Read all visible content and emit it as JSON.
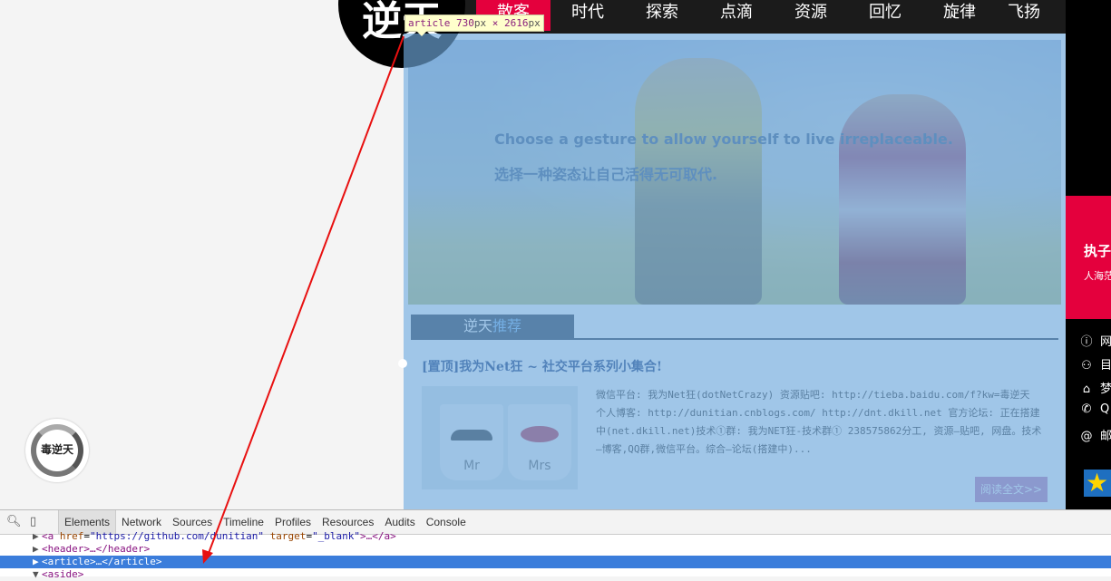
{
  "left": {
    "widget_text": "毒逆天"
  },
  "logo": {
    "text": "逆天"
  },
  "nav": {
    "items": [
      {
        "label": "散客",
        "active": true
      },
      {
        "label": "时代"
      },
      {
        "label": "探索"
      },
      {
        "label": "点滴"
      },
      {
        "label": "资源"
      },
      {
        "label": "回忆"
      },
      {
        "label": "旋律"
      },
      {
        "label": "飞扬"
      }
    ]
  },
  "inspect_tooltip": {
    "tag": "article",
    "width": "730",
    "unit": "px",
    "times": "×",
    "height": "2616"
  },
  "hero": {
    "line1": "Choose a gesture to allow yourself to live irreplaceable.",
    "line2": "选择一种姿态让自己活得无可取代."
  },
  "section": {
    "tab_prefix": "逆天",
    "tab_highlight": "推荐"
  },
  "post": {
    "title": "[置顶]我为Net狂 ~ 社交平台系列小集合!",
    "thumb_left": "Mr",
    "thumb_right": "Mrs",
    "excerpt": "微信平台: 我为Net狂(dotNetCrazy) 资源贴吧: http://tieba.baidu.com/f?kw=毒逆天 个人博客: http://dunitian.cnblogs.com/ http://dnt.dkill.net 官方论坛: 正在搭建中(net.dkill.net)技术①群: 我为NET狂-技术群① 238575862分工, 资源—贴吧, 网盘。技术—博客,QQ群,微信平台。综合—论坛(搭建中)...",
    "read_more": "阅读全文>>"
  },
  "aside": {
    "red_title": "执子",
    "red_sub": "人海茫",
    "info": [
      {
        "icon": "ⓘ",
        "text": "网"
      },
      {
        "icon": "⚇",
        "text": "目"
      },
      {
        "icon": "⌂",
        "text": "梦"
      },
      {
        "icon": "✆",
        "text": "Q"
      },
      {
        "icon": "@",
        "text": "邮"
      }
    ],
    "star": "★"
  },
  "devtools": {
    "tabs": [
      {
        "label": "Elements",
        "active": true
      },
      {
        "label": "Network"
      },
      {
        "label": "Sources"
      },
      {
        "label": "Timeline"
      },
      {
        "label": "Profiles"
      },
      {
        "label": "Resources"
      },
      {
        "label": "Audits"
      },
      {
        "label": "Console"
      }
    ],
    "dom": {
      "line0_tag_open": "<a",
      "line0_attr1": "href",
      "line0_val1": "\"https://github.com/dunitian\"",
      "line0_attr2": "target",
      "line0_val2": "\"_blank\"",
      "line0_rest": ">…</a>",
      "line1": "<header>…</header>",
      "line2": "<article>…</article>",
      "line3": "<aside>"
    }
  },
  "colors": {
    "accent_red": "#e4003d",
    "highlight_blue": "#6fa8dc",
    "selection_blue": "#3b7ddb"
  }
}
